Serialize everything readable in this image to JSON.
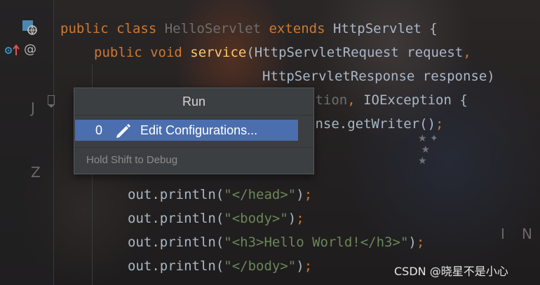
{
  "editor": {
    "lines": [
      {
        "t": [
          [
            "kw",
            "public class "
          ],
          [
            "dim",
            "HelloServlet "
          ],
          [
            "kw",
            "extends "
          ],
          [
            "cls",
            "HttpServlet {"
          ]
        ]
      },
      {
        "t": [
          [
            "kw",
            "public void "
          ],
          [
            "fn",
            "service"
          ],
          [
            "cls",
            "(HttpServletRequest request"
          ],
          [
            "kw",
            ","
          ]
        ]
      },
      {
        "t": [
          [
            "cls",
            "HttpServletResponse response)"
          ]
        ]
      },
      {
        "t": [
          [
            "dim",
            "ption"
          ],
          [
            "kw",
            ", "
          ],
          [
            "cls",
            "IOException {"
          ]
        ]
      },
      {
        "t": [
          [
            "cls",
            "onse.getWriter()"
          ],
          [
            "kw",
            ";"
          ]
        ]
      },
      {
        "t": [
          [
            "cls",
            "out.println("
          ],
          [
            "str",
            "\"</head>\""
          ],
          [
            "cls",
            ")"
          ],
          [
            "kw",
            ";"
          ]
        ]
      },
      {
        "t": [
          [
            "cls",
            "out.println("
          ],
          [
            "str",
            "\"<body>\""
          ],
          [
            "cls",
            ")"
          ],
          [
            "kw",
            ";"
          ]
        ]
      },
      {
        "t": [
          [
            "cls",
            "out.println("
          ],
          [
            "str",
            "\"<h3>Hello World!</h3>\""
          ],
          [
            "cls",
            ")"
          ],
          [
            "kw",
            ";"
          ]
        ]
      },
      {
        "t": [
          [
            "cls",
            "out.println("
          ],
          [
            "str",
            "\"</body>\""
          ],
          [
            "cls",
            ")"
          ],
          [
            "kw",
            ";"
          ]
        ]
      }
    ]
  },
  "gutter": {
    "icons": [
      "class-icon",
      "override-icon",
      "annotation-icon"
    ],
    "at_symbol": "@"
  },
  "popup": {
    "title": "Run",
    "item_number": "0",
    "item_label": "Edit Configurations...",
    "hint": "Hold Shift to Debug"
  },
  "watermark": "CSDN @晓星不是小心",
  "colors": {
    "keyword": "#cc7832",
    "method": "#ffc66d",
    "string": "#6a8759",
    "text": "#a9b7c6",
    "selection": "#4b6eaf"
  }
}
